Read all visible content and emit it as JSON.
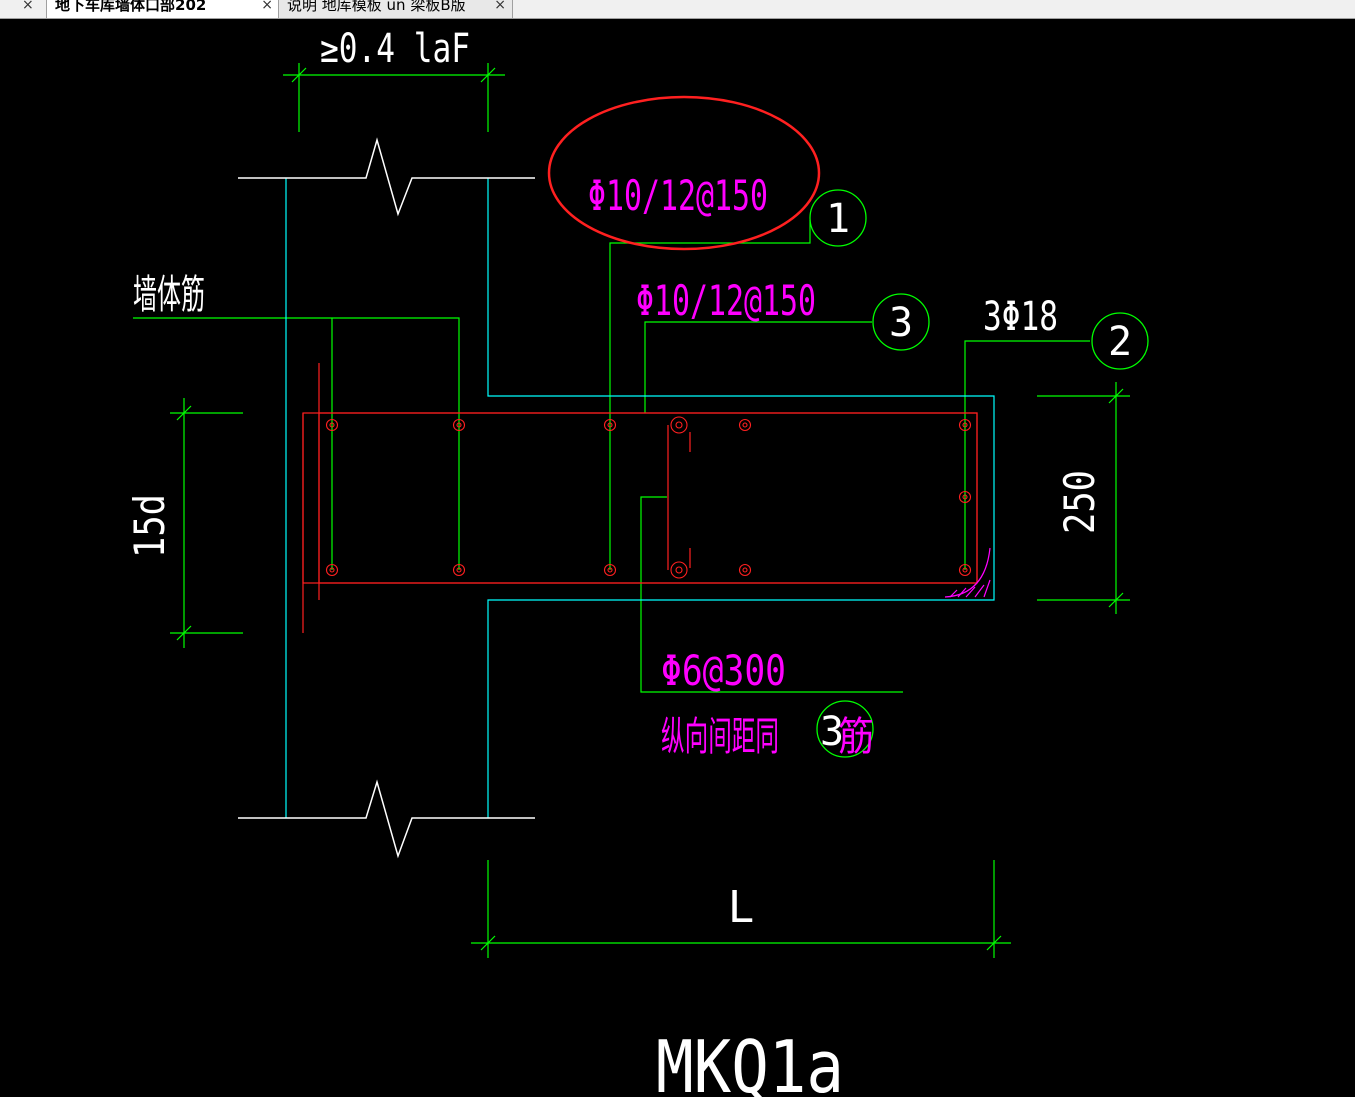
{
  "tabs": [
    {
      "label": "地下车库墙体口部202",
      "active": true
    },
    {
      "label": "说明 地库模板 un 梁板B版",
      "active": false
    }
  ],
  "tab_close_glyph": "×",
  "drawing": {
    "dim_top": "≥0.4 laF",
    "label_1": "Φ10/12@150",
    "label_3": "Φ10/12@150",
    "label_2": "3Φ18",
    "wall_rebar": "墙体筋",
    "dim_left": "15d",
    "dim_right": "250",
    "stirrup": "Φ6@300",
    "stirrup_note": "纵向间距同",
    "stirrup_note_suffix": "筋",
    "circle_1": "1",
    "circle_2": "2",
    "circle_3": "3",
    "circle_3b": "3",
    "dim_bottom": "L",
    "title": "MKQ1a"
  },
  "colors": {
    "background": "#000000",
    "dimension": "#00ff00",
    "outline": "#00ffff",
    "rebar": "#ff0000",
    "annotation": "#ff00ff",
    "white": "#ffffff",
    "highlight_ellipse": "#ff2020"
  }
}
